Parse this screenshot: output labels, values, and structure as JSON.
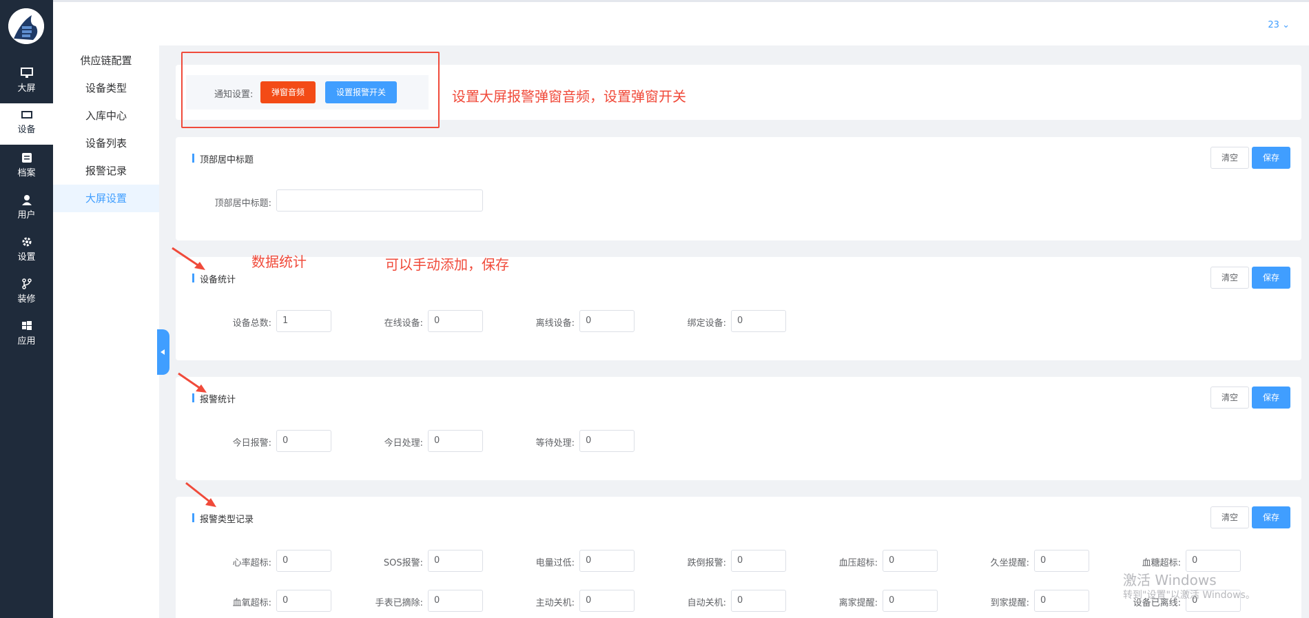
{
  "rail": [
    {
      "icon": "monitor-icon",
      "label": "大屏"
    },
    {
      "icon": "device-icon",
      "label": "设备"
    },
    {
      "icon": "archive-icon",
      "label": "档案"
    },
    {
      "icon": "user-icon",
      "label": "用户"
    },
    {
      "icon": "gear-icon",
      "label": "设置"
    },
    {
      "icon": "branch-icon",
      "label": "装修"
    },
    {
      "icon": "windows-icon",
      "label": "应用"
    }
  ],
  "submenu": [
    "供应链配置",
    "设备类型",
    "入库中心",
    "设备列表",
    "报警记录",
    "大屏设置"
  ],
  "header": {
    "user": "23"
  },
  "notice": {
    "label": "通知设置:",
    "sound_button": "弹窗音频",
    "switch_button": "设置报警开关"
  },
  "buttons": {
    "clear": "清空",
    "save": "保存"
  },
  "title_section": {
    "title": "顶部居中标题",
    "field_label": "顶部居中标题:",
    "field_value": ""
  },
  "device_stats": {
    "title": "设备统计",
    "fields": [
      {
        "label": "设备总数:",
        "value": "1"
      },
      {
        "label": "在线设备:",
        "value": "0"
      },
      {
        "label": "离线设备:",
        "value": "0"
      },
      {
        "label": "绑定设备:",
        "value": "0"
      }
    ]
  },
  "alarm_stats": {
    "title": "报警统计",
    "fields": [
      {
        "label": "今日报警:",
        "value": "0"
      },
      {
        "label": "今日处理:",
        "value": "0"
      },
      {
        "label": "等待处理:",
        "value": "0"
      }
    ]
  },
  "alarm_types": {
    "title": "报警类型记录",
    "fields": [
      {
        "label": "心率超标:",
        "value": "0"
      },
      {
        "label": "SOS报警:",
        "value": "0"
      },
      {
        "label": "电量过低:",
        "value": "0"
      },
      {
        "label": "跌倒报警:",
        "value": "0"
      },
      {
        "label": "血压超标:",
        "value": "0"
      },
      {
        "label": "久坐提醒:",
        "value": "0"
      },
      {
        "label": "血糖超标:",
        "value": "0"
      },
      {
        "label": "血氧超标:",
        "value": "0"
      },
      {
        "label": "手表已摘除:",
        "value": "0"
      },
      {
        "label": "主动关机:",
        "value": "0"
      },
      {
        "label": "自动关机:",
        "value": "0"
      },
      {
        "label": "离家提醒:",
        "value": "0"
      },
      {
        "label": "到家提醒:",
        "value": "0"
      },
      {
        "label": "设备已离线:",
        "value": "0"
      }
    ]
  },
  "annotations": {
    "popup": "设置大屏报警弹窗音频，设置弹窗开关",
    "stats": "数据统计",
    "manual": "可以手动添加，保存"
  },
  "watermark": {
    "line1": "激活 Windows",
    "line2": "转到\"设置\"以激活 Windows。"
  },
  "colors": {
    "sidebar": "#1f2b3b",
    "primary": "#409eff",
    "danger": "#f34b16",
    "annotation": "#f04a3a"
  }
}
